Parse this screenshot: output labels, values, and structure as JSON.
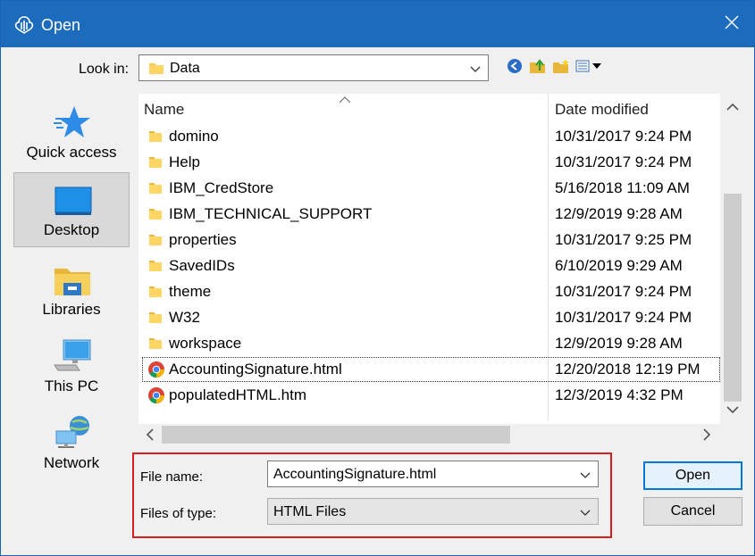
{
  "window": {
    "title": "Open",
    "close_icon": "close-icon"
  },
  "lookin": {
    "label": "Look in:",
    "value": "Data"
  },
  "toolbar": {
    "icons": [
      "back-icon",
      "up-folder-icon",
      "new-folder-icon",
      "view-menu-icon"
    ]
  },
  "places": [
    {
      "label": "Quick access",
      "icon": "quick-access-star-icon"
    },
    {
      "label": "Desktop",
      "icon": "desktop-icon"
    },
    {
      "label": "Libraries",
      "icon": "libraries-icon"
    },
    {
      "label": "This PC",
      "icon": "this-pc-icon"
    },
    {
      "label": "Network",
      "icon": "network-icon"
    }
  ],
  "filelist": {
    "columns": {
      "name": "Name",
      "date": "Date modified"
    },
    "rows": [
      {
        "name": "domino",
        "date": "10/31/2017 9:24 PM",
        "type": "folder"
      },
      {
        "name": "Help",
        "date": "10/31/2017 9:24 PM",
        "type": "folder"
      },
      {
        "name": "IBM_CredStore",
        "date": "5/16/2018 11:09 AM",
        "type": "folder"
      },
      {
        "name": "IBM_TECHNICAL_SUPPORT",
        "date": "12/9/2019 9:28 AM",
        "type": "folder"
      },
      {
        "name": "properties",
        "date": "10/31/2017 9:25 PM",
        "type": "folder"
      },
      {
        "name": "SavedIDs",
        "date": "6/10/2019 9:29 AM",
        "type": "folder"
      },
      {
        "name": "theme",
        "date": "10/31/2017 9:24 PM",
        "type": "folder"
      },
      {
        "name": "W32",
        "date": "10/31/2017 9:24 PM",
        "type": "folder"
      },
      {
        "name": "workspace",
        "date": "12/9/2019 9:28 AM",
        "type": "folder"
      },
      {
        "name": "AccountingSignature.html",
        "date": "12/20/2018 12:19 PM",
        "type": "chrome"
      },
      {
        "name": "populatedHTML.htm",
        "date": "12/3/2019 4:32 PM",
        "type": "chrome"
      }
    ]
  },
  "form": {
    "filename_label": "File name:",
    "filename_value": "AccountingSignature.html",
    "filetype_label": "Files of type:",
    "filetype_value": "HTML Files"
  },
  "buttons": {
    "open": "Open",
    "cancel": "Cancel"
  },
  "colors": {
    "titlebar": "#1c6bbd",
    "highlight_border": "#d42020",
    "default_button_border": "#0078d7"
  }
}
